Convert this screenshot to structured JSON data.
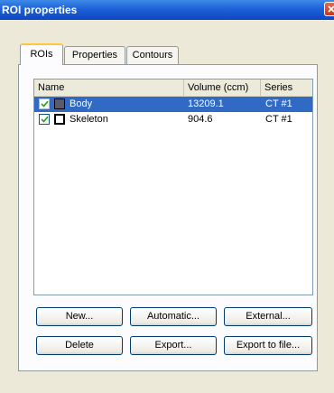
{
  "window": {
    "title": "ROI properties"
  },
  "tabs": [
    {
      "label": "ROIs"
    },
    {
      "label": "Properties"
    },
    {
      "label": "Contours"
    }
  ],
  "list": {
    "columns": [
      "Name",
      "Volume (ccm)",
      "Series"
    ],
    "rows": [
      {
        "checked": true,
        "color": "#5a5a6e",
        "name": "Body",
        "volume": "13209.1",
        "series": "CT #1",
        "selected": true
      },
      {
        "checked": true,
        "color": "#ffffff",
        "name": "Skeleton",
        "volume": "904.6",
        "series": "CT #1",
        "selected": false
      }
    ]
  },
  "buttons": {
    "new": "New...",
    "automatic": "Automatic...",
    "external": "External...",
    "delete": "Delete",
    "export": "Export...",
    "export_file": "Export to file..."
  },
  "colors": {
    "title_bar": "#0b47c2",
    "selection": "#316ac5",
    "active_tab_accent": "#ffc83c"
  }
}
